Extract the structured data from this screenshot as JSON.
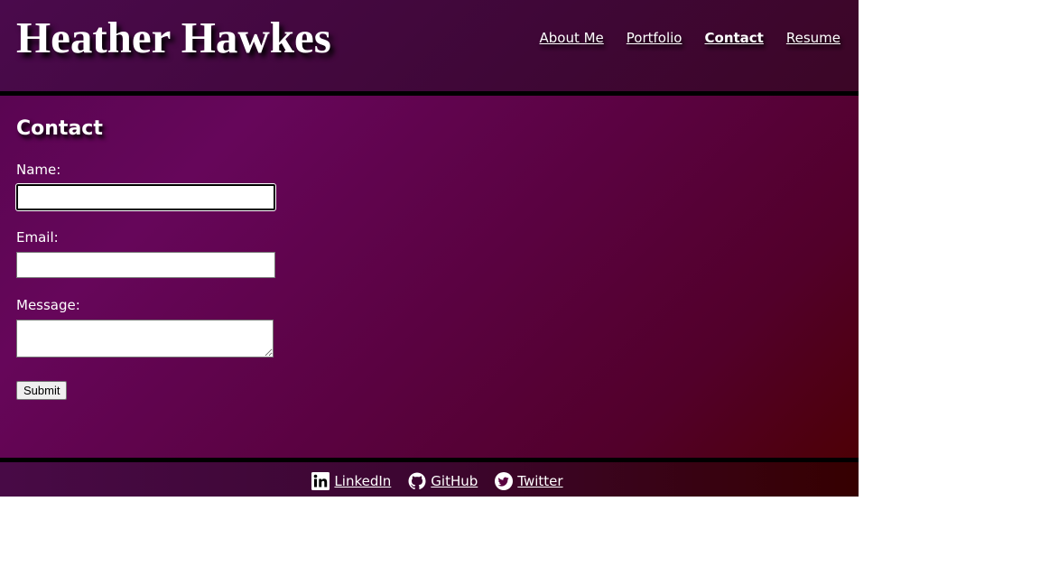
{
  "header": {
    "site_title": "Heather Hawkes",
    "nav": [
      {
        "label": "About Me",
        "active": false
      },
      {
        "label": "Portfolio",
        "active": false
      },
      {
        "label": "Contact",
        "active": true
      },
      {
        "label": "Resume",
        "active": false
      }
    ]
  },
  "main": {
    "heading": "Contact",
    "form": {
      "name_label": "Name:",
      "name_value": "",
      "email_label": "Email:",
      "email_value": "",
      "message_label": "Message:",
      "message_value": "",
      "submit_label": "Submit"
    }
  },
  "footer": {
    "links": [
      {
        "label": "LinkedIn",
        "icon": "linkedin-icon"
      },
      {
        "label": "GitHub",
        "icon": "github-icon"
      },
      {
        "label": "Twitter",
        "icon": "twitter-icon"
      }
    ]
  },
  "colors": {
    "header_bg": "#420838",
    "main_gradient_start": "#66065a",
    "main_gradient_end": "#4d0006",
    "border": "#000000",
    "text": "#ffffff"
  }
}
